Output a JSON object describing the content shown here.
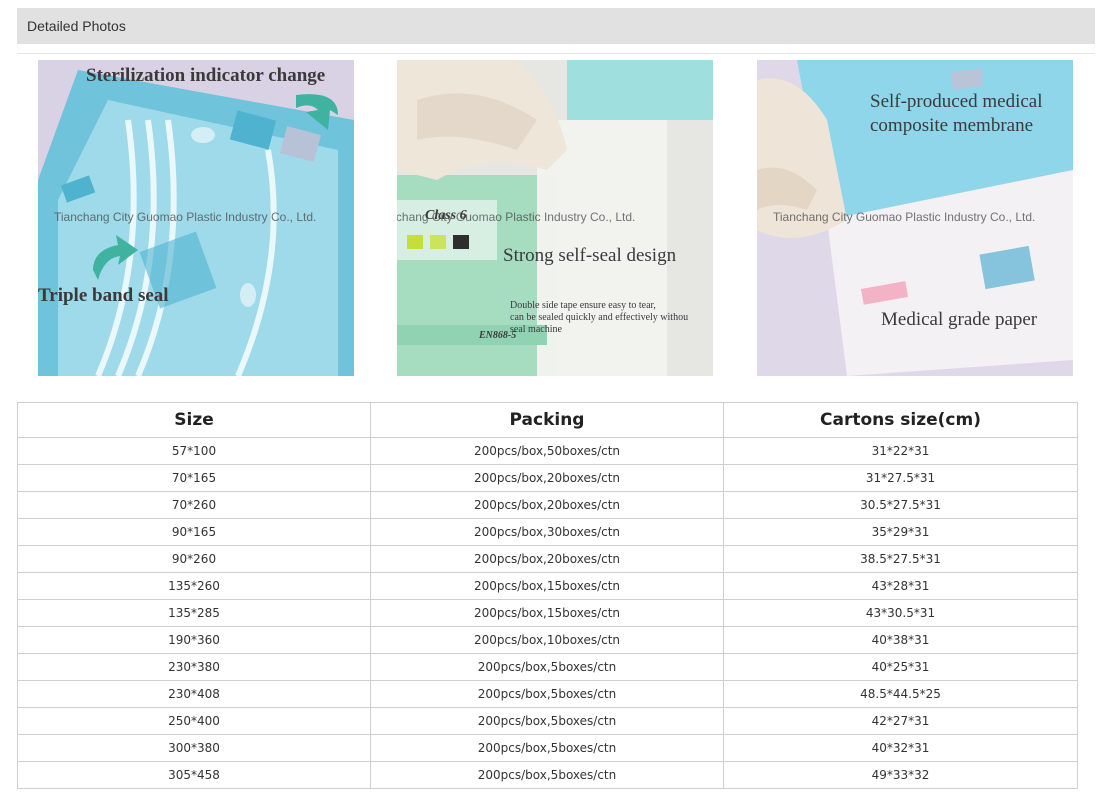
{
  "section": {
    "title": "Detailed Photos"
  },
  "watermark": "Tianchang City Guomao Plastic Industry Co., Ltd.",
  "photos": [
    {
      "labels": [
        "Sterilization indicator change",
        "Triple band seal"
      ]
    },
    {
      "labels": [
        "Strong self-seal design",
        "Double side tape ensure easy to tear,",
        "can be sealed quickly and effectively withou",
        "seal machine"
      ],
      "print": [
        "Class 6",
        "EN868-5"
      ]
    },
    {
      "labels": [
        "Self-produced medical",
        "composite membrane",
        "Medical grade paper"
      ]
    }
  ],
  "table": {
    "headers": [
      "Size",
      "Packing",
      "Cartons size(cm)"
    ],
    "rows": [
      [
        "57*100",
        "200pcs/box,50boxes/ctn",
        "31*22*31"
      ],
      [
        "70*165",
        "200pcs/box,20boxes/ctn",
        "31*27.5*31"
      ],
      [
        "70*260",
        "200pcs/box,20boxes/ctn",
        "30.5*27.5*31"
      ],
      [
        "90*165",
        "200pcs/box,30boxes/ctn",
        "35*29*31"
      ],
      [
        "90*260",
        "200pcs/box,20boxes/ctn",
        "38.5*27.5*31"
      ],
      [
        "135*260",
        "200pcs/box,15boxes/ctn",
        "43*28*31"
      ],
      [
        "135*285",
        "200pcs/box,15boxes/ctn",
        "43*30.5*31"
      ],
      [
        "190*360",
        "200pcs/box,10boxes/ctn",
        "40*38*31"
      ],
      [
        "230*380",
        "200pcs/box,5boxes/ctn",
        "40*25*31"
      ],
      [
        "230*408",
        "200pcs/box,5boxes/ctn",
        "48.5*44.5*25"
      ],
      [
        "250*400",
        "200pcs/box,5boxes/ctn",
        "42*27*31"
      ],
      [
        "300*380",
        "200pcs/box,5boxes/ctn",
        "40*32*31"
      ],
      [
        "305*458",
        "200pcs/box,5boxes/ctn",
        "49*33*32"
      ]
    ]
  }
}
